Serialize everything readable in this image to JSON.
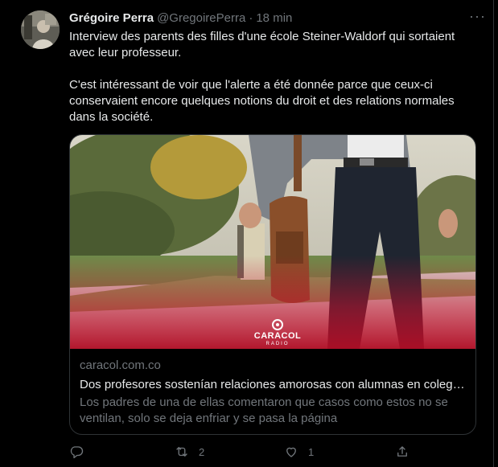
{
  "author": {
    "name": "Grégoire Perra",
    "handle": "@GregoirePerra",
    "separator": "·",
    "time": "18 min"
  },
  "more_label": "···",
  "tweet_text": "Interview des parents des filles d'une école Steiner-Waldorf qui sortaient avec leur professeur.\n\nC'est intéressant de voir que l'alerte a été donnée parce que ceux-ci conservaient encore quelques notions du droit et des relations normales dans la société.",
  "card": {
    "domain": "caracol.com.co",
    "title": "Dos profesores sostenían relaciones amorosas con alumnas en colegi…",
    "description": "Los padres de una de ellas comentaron que casos como estos no se ventilan, solo se deja enfriar y se pasa la página",
    "logo_text": "CARACOL",
    "logo_sub": "RADIO"
  },
  "actions": {
    "reply_count": "",
    "retweet_count": "2",
    "like_count": "1",
    "share_count": ""
  },
  "icons": {
    "reply": "reply-icon",
    "retweet": "retweet-icon",
    "like": "heart-icon",
    "share": "share-icon",
    "more": "more-icon"
  },
  "colors": {
    "background": "#000000",
    "text": "#e7e9ea",
    "muted": "#71767b",
    "border": "#2f3336",
    "brand_red": "#c8102e"
  }
}
